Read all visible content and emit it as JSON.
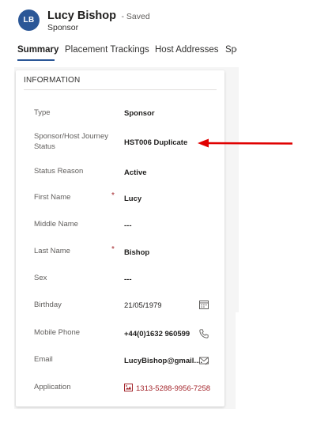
{
  "header": {
    "avatar_initials": "LB",
    "title": "Lucy Bishop",
    "saved_status": "- Saved",
    "entity": "Sponsor"
  },
  "tabs": [
    {
      "label": "Summary",
      "active": true
    },
    {
      "label": "Placement Trackings",
      "active": false
    },
    {
      "label": "Host Addresses",
      "active": false
    },
    {
      "label": "Spo",
      "active": false
    }
  ],
  "section": {
    "title": "INFORMATION",
    "fields": [
      {
        "label": "Type",
        "value": "Sponsor"
      },
      {
        "label": "Sponsor/Host Journey Status",
        "value": "HST006 Duplicate"
      },
      {
        "label": "Status Reason",
        "value": "Active"
      },
      {
        "label": "First Name",
        "value": "Lucy",
        "required": true
      },
      {
        "label": "Middle Name",
        "value": "---"
      },
      {
        "label": "Last Name",
        "value": "Bishop",
        "required": true
      },
      {
        "label": "Sex",
        "value": "---"
      },
      {
        "label": "Birthday",
        "value": "21/05/1979",
        "icon": "calendar-icon"
      },
      {
        "label": "Mobile Phone",
        "value": "+44(0)1632 960599",
        "icon": "phone-icon"
      },
      {
        "label": "Email",
        "value": "LucyBishop@gmail....",
        "icon": "email-icon"
      },
      {
        "label": "Application",
        "value": "1313-5288-9956-7258",
        "icon": "application-record-icon"
      }
    ],
    "required_marker": "*"
  },
  "annotation": {
    "arrow_color": "#e00000"
  },
  "colors": {
    "avatar_bg": "#2b5797",
    "accent": "#2b5797",
    "required": "#a4262c",
    "link": "#a4262c"
  }
}
